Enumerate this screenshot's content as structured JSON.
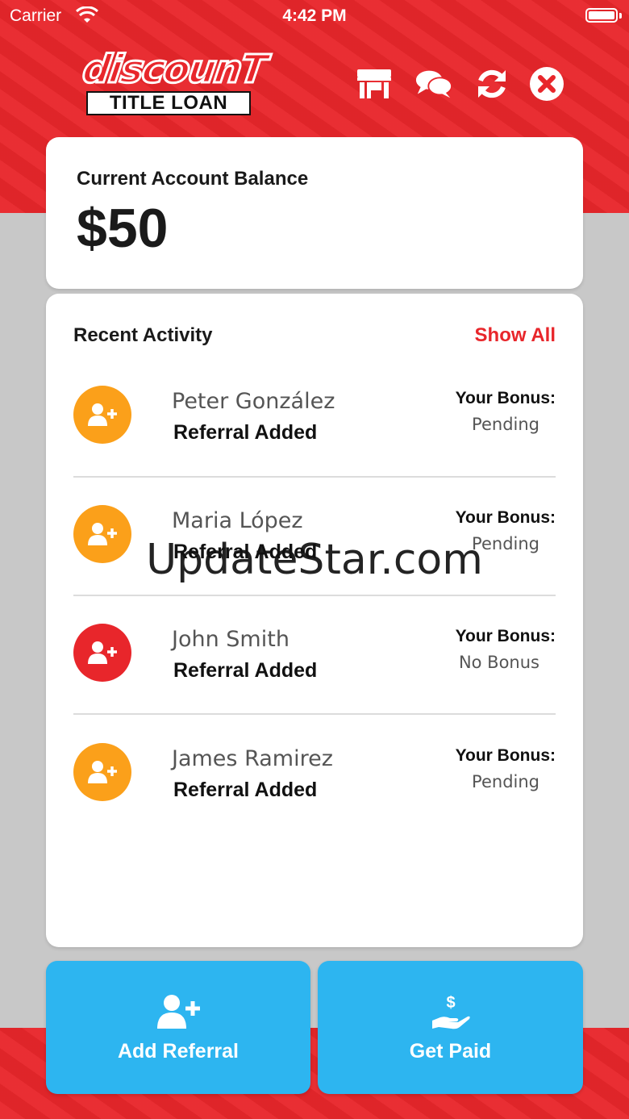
{
  "status_bar": {
    "carrier": "Carrier",
    "time": "4:42 PM"
  },
  "brand": {
    "script": "discounT",
    "box": "TITLE LOAN",
    "accent": "#e8262b"
  },
  "header_icons": [
    "store-icon",
    "chat-icon",
    "refresh-icon",
    "close-icon"
  ],
  "balance": {
    "label": "Current Account Balance",
    "value": "$50"
  },
  "activity": {
    "title": "Recent Activity",
    "show_all": "Show All",
    "items": [
      {
        "name": "Peter González",
        "status": "Referral Added",
        "bonus_label": "Your Bonus:",
        "bonus_value": "Pending",
        "color": "#fba01a"
      },
      {
        "name": "Maria López",
        "status": "Referral Added",
        "bonus_label": "Your Bonus:",
        "bonus_value": "Pending",
        "color": "#fba01a"
      },
      {
        "name": "John Smith",
        "status": "Referral Added",
        "bonus_label": "Your Bonus:",
        "bonus_value": "No Bonus",
        "color": "#e8262b"
      },
      {
        "name": "James Ramirez",
        "status": "Referral Added",
        "bonus_label": "Your Bonus:",
        "bonus_value": "Pending",
        "color": "#fba01a"
      }
    ]
  },
  "watermark": "UpdateStar.com",
  "actions": {
    "add_referral": "Add Referral",
    "get_paid": "Get Paid",
    "color": "#2db5f0"
  }
}
